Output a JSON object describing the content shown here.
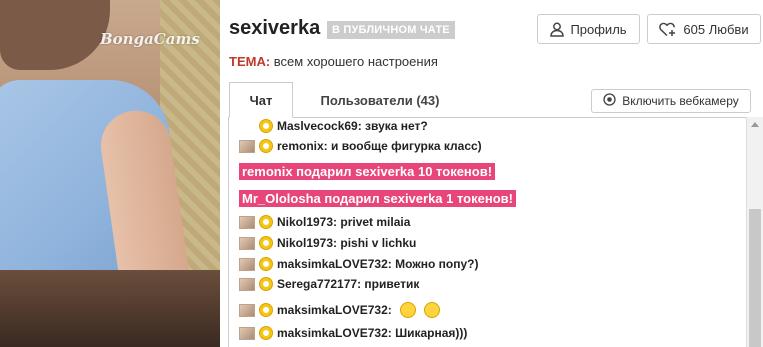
{
  "video": {
    "logo_text": "BongaCams"
  },
  "header": {
    "model_name": "sexiverka",
    "status_badge": "В ПУБЛИЧНОМ ЧАТЕ",
    "profile_label": "Профиль",
    "love_label": "605 Любви"
  },
  "topic": {
    "label": "ТЕМА:",
    "text": "всем хорошего настроения"
  },
  "tabs": {
    "chat": "Чат",
    "users": "Пользователи (43)"
  },
  "webcam_button": "Включить вебкамеру",
  "chat": {
    "messages": [
      {
        "text": "Maslvecock69: звука нет?",
        "avatar": false
      },
      {
        "text": "remonix: и вообще фигурка класс)",
        "avatar": true
      },
      {
        "text": "Nikol1973: privet milaia",
        "avatar": true
      },
      {
        "text": "Nikol1973: pishi v lichku",
        "avatar": true
      },
      {
        "text": "maksimkaLOVE732: Можно попу?)",
        "avatar": true
      },
      {
        "text": "Serega772177: приветик",
        "avatar": true
      },
      {
        "text": "maksimkaLOVE732:",
        "avatar": true,
        "emojis": [
          "confused-emoji-icon",
          "thumbs-up-emoji-icon"
        ]
      },
      {
        "text": "maksimkaLOVE732: Шикарная)))",
        "avatar": true
      }
    ],
    "tips": [
      "remonix подарил sexiverka 10 токенов!",
      "Mr_Ololosha подарил sexiverka 1 токенов!"
    ]
  },
  "colors": {
    "accent": "#c0392b",
    "tip_bg": "#e8457a",
    "badge_bg": "#cccccc",
    "coin": "#f5c518"
  }
}
